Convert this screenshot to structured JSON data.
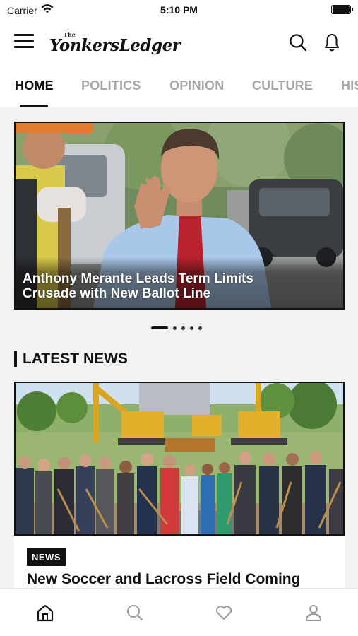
{
  "status_bar": {
    "carrier": "Carrier",
    "time": "5:10 PM",
    "wifi_icon": "wifi-icon",
    "battery_icon": "battery-full-icon",
    "battery_level": 1.0
  },
  "header": {
    "menu_icon": "hamburger-menu-icon",
    "logo_small": "The",
    "logo_text": "YonkersLedger",
    "search_icon": "search-icon",
    "notifications_icon": "bell-icon"
  },
  "tabs": [
    {
      "label": "HOME",
      "active": true
    },
    {
      "label": "POLITICS",
      "active": false
    },
    {
      "label": "OPINION",
      "active": false
    },
    {
      "label": "CULTURE",
      "active": false
    },
    {
      "label": "HIS",
      "active": false
    }
  ],
  "hero": {
    "title": "Anthony Merante Leads Term Limits Crusade with New Ballot Line",
    "slide_count": 5,
    "active_slide": 1
  },
  "latest_news": {
    "section_title": "LATEST NEWS",
    "items": [
      {
        "badge": "NEWS",
        "title": "New Soccer and Lacross Field Coming"
      }
    ]
  },
  "bottom_nav": [
    {
      "icon": "home-icon",
      "active": true
    },
    {
      "icon": "search-icon",
      "active": false
    },
    {
      "icon": "heart-icon",
      "active": false
    },
    {
      "icon": "profile-icon",
      "active": false
    }
  ],
  "colors": {
    "active_text": "#111111",
    "inactive_tab": "#a8a8a8",
    "content_bg": "#f2f2f2",
    "badge_bg": "#111111",
    "inactive_nav_icon": "#9a9a9a"
  }
}
